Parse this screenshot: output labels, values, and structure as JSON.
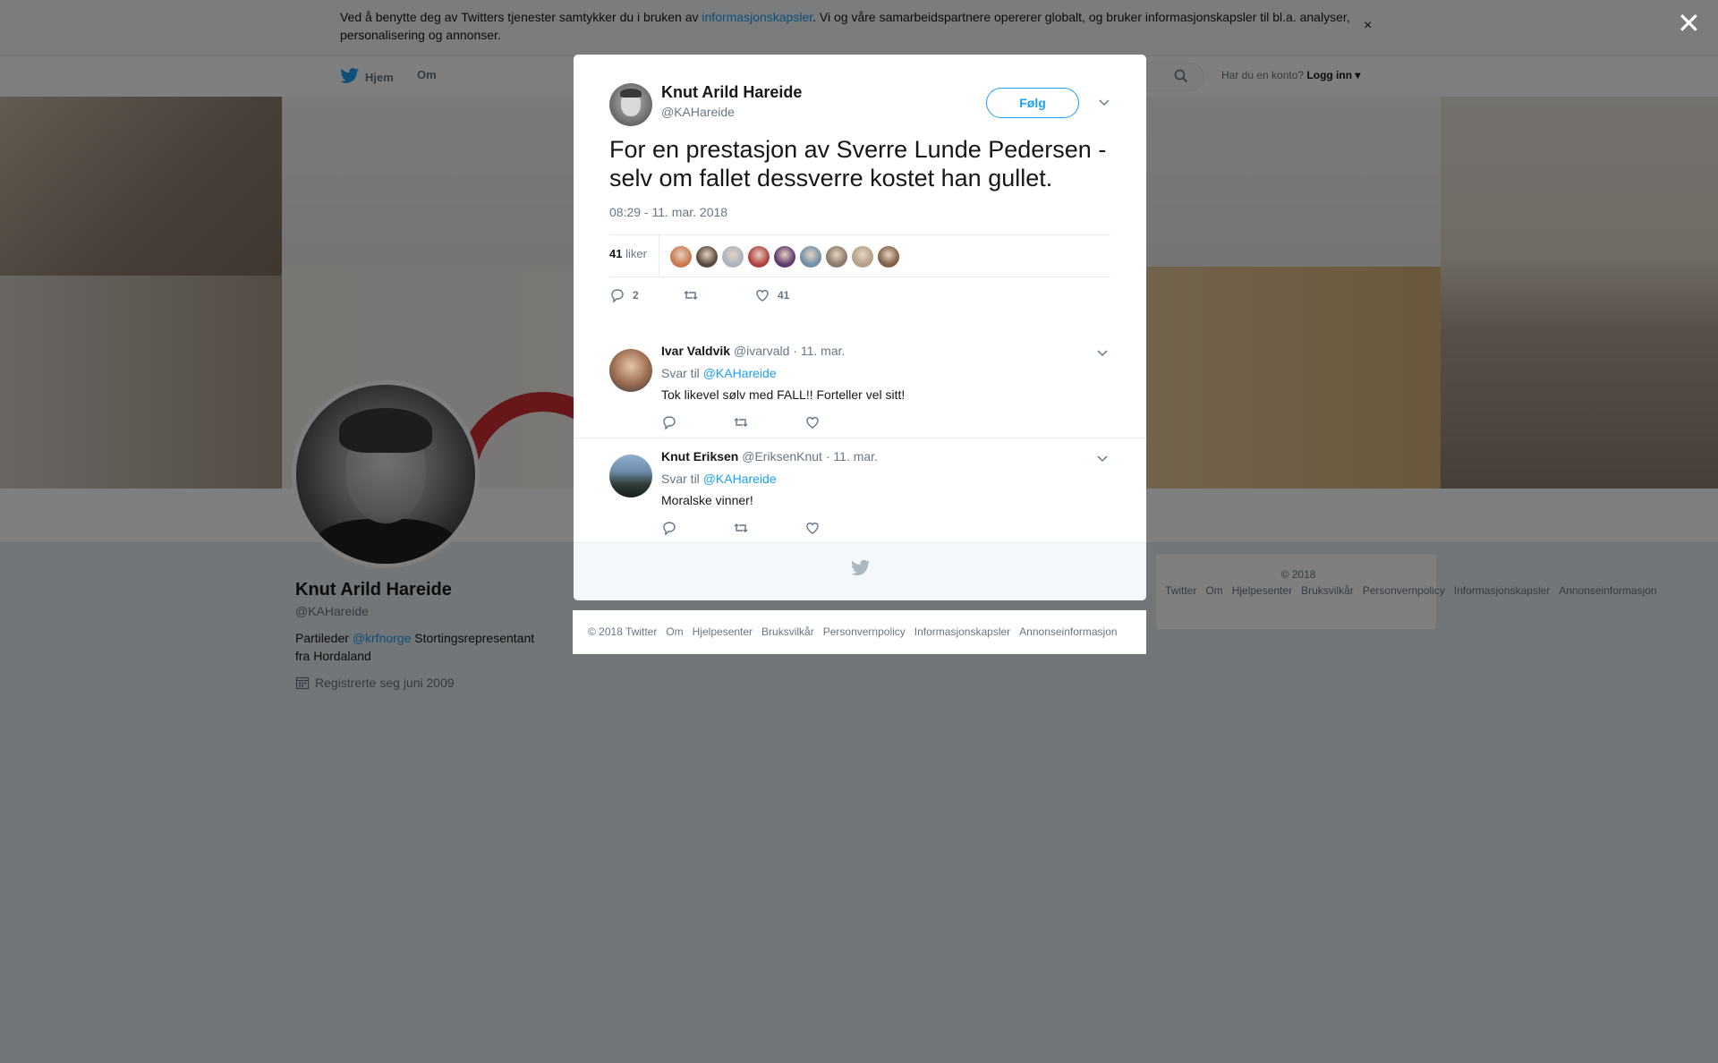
{
  "cookie_banner": {
    "text_before": "Ved å benytte deg av Twitters tjenester samtykker du i bruken av ",
    "link": "informasjonskapsler",
    "text_after": ". Vi og våre samarbeidspartnere opererer globalt, og bruker informasjonskapsler til bl.a. analyser, personalisering og annonser.",
    "close": "×"
  },
  "nav": {
    "home": "Hjem",
    "about": "Om",
    "login_prompt": "Har du en konto?",
    "login": "Logg inn"
  },
  "profile": {
    "name": "Knut Arild Hareide",
    "handle": "@KAHareide",
    "bio_before": "Partileder ",
    "bio_link": "@krfnorge",
    "bio_after": " Stortingsrepresentant fra Hordaland",
    "joined": "Registrerte seg juni 2009"
  },
  "side_footer": {
    "links": [
      "© 2018 Twitter",
      "Om",
      "Hjelpesenter",
      "Bruksvilkår",
      "Personvernpolicy",
      "Informasjonskapsler",
      "Annonseinformasjon"
    ]
  },
  "overlay": {
    "close": "✕"
  },
  "tweet": {
    "author_name": "Knut Arild Hareide",
    "author_handle": "@KAHareide",
    "follow": "Følg",
    "text": "For en prestasjon av Sverre Lunde Pedersen - selv om fallet dessverre kostet han gullet.",
    "timestamp": "08:29 - 11. mar. 2018",
    "likes_count": "41",
    "likes_label": "liker",
    "replies_count": "2",
    "like_action_count": "41",
    "liker_colors": [
      "#c9794e",
      "#5a4a3e",
      "#a9b4bf",
      "#b04040",
      "#5d3b6e",
      "#6f8fa8",
      "#8a7a6a",
      "#b6a28a",
      "#806048"
    ]
  },
  "replies": [
    {
      "name": "Ivar Valdvik",
      "handle": "@ivarvald",
      "date": "· 11. mar.",
      "reply_to_label": "Svar til",
      "reply_to": "@KAHareide",
      "text": "Tok likevel sølv med FALL!! Forteller vel sitt!"
    },
    {
      "name": "Knut Eriksen",
      "handle": "@EriksenKnut",
      "date": "· 11. mar.",
      "reply_to_label": "Svar til",
      "reply_to": "@KAHareide",
      "text": "Moralske vinner!"
    }
  ],
  "legal": {
    "links": [
      "© 2018 Twitter",
      "Om",
      "Hjelpesenter",
      "Bruksvilkår",
      "Personvernpolicy",
      "Informasjonskapsler",
      "Annonseinformasjon"
    ]
  },
  "colors": {
    "accent": "#1da1f2",
    "text": "#14171a",
    "muted": "#657786",
    "overlay": "rgba(0,0,0,0.5)"
  }
}
